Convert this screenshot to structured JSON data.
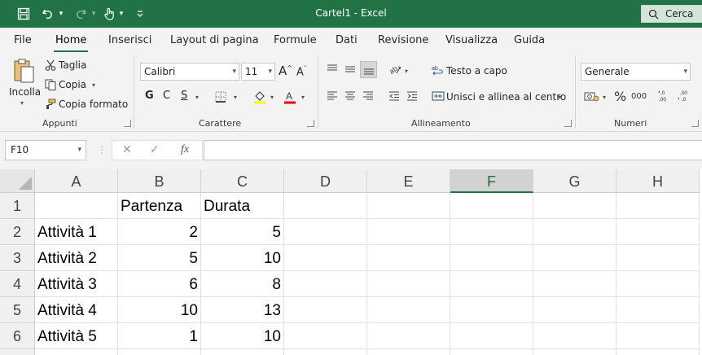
{
  "window": {
    "title": "Cartel1  -  Excel",
    "search_label": "Cerca"
  },
  "menu": {
    "tabs": [
      "File",
      "Home",
      "Inserisci",
      "Layout di pagina",
      "Formule",
      "Dati",
      "Revisione",
      "Visualizza",
      "Guida"
    ],
    "active": "Home"
  },
  "ribbon": {
    "clipboard": {
      "paste": "Incolla",
      "cut": "Taglia",
      "copy": "Copia",
      "format_painter": "Copia formato",
      "label": "Appunti"
    },
    "font": {
      "font_name": "Calibri",
      "font_size": "11",
      "grow": "A",
      "shrink": "A",
      "bold": "G",
      "italic": "C",
      "underline": "S",
      "label": "Carattere"
    },
    "alignment": {
      "wrap_text": "Testo a capo",
      "merge_center": "Unisci e allinea al centro",
      "label": "Allineamento"
    },
    "number": {
      "format": "Generale",
      "percent": "%",
      "thousands": "000",
      "label": "Numeri"
    }
  },
  "formula_bar": {
    "name_box": "F10",
    "fx": "fx",
    "formula": ""
  },
  "sheet": {
    "columns": [
      "A",
      "B",
      "C",
      "D",
      "E",
      "F",
      "G",
      "H"
    ],
    "selected_column": "F",
    "rows": [
      {
        "num": "1",
        "A": "",
        "B": "Partenza",
        "C": "Durata"
      },
      {
        "num": "2",
        "A": "Attività 1",
        "B": "2",
        "C": "5"
      },
      {
        "num": "3",
        "A": "Attività 2",
        "B": "5",
        "C": "10"
      },
      {
        "num": "4",
        "A": "Attività 3",
        "B": "6",
        "C": "8"
      },
      {
        "num": "5",
        "A": "Attività 4",
        "B": "10",
        "C": "13"
      },
      {
        "num": "6",
        "A": "Attività 5",
        "B": "1",
        "C": "10"
      }
    ]
  },
  "colors": {
    "excel_green": "#217346",
    "ribbon_bg": "#f3f3f3"
  }
}
